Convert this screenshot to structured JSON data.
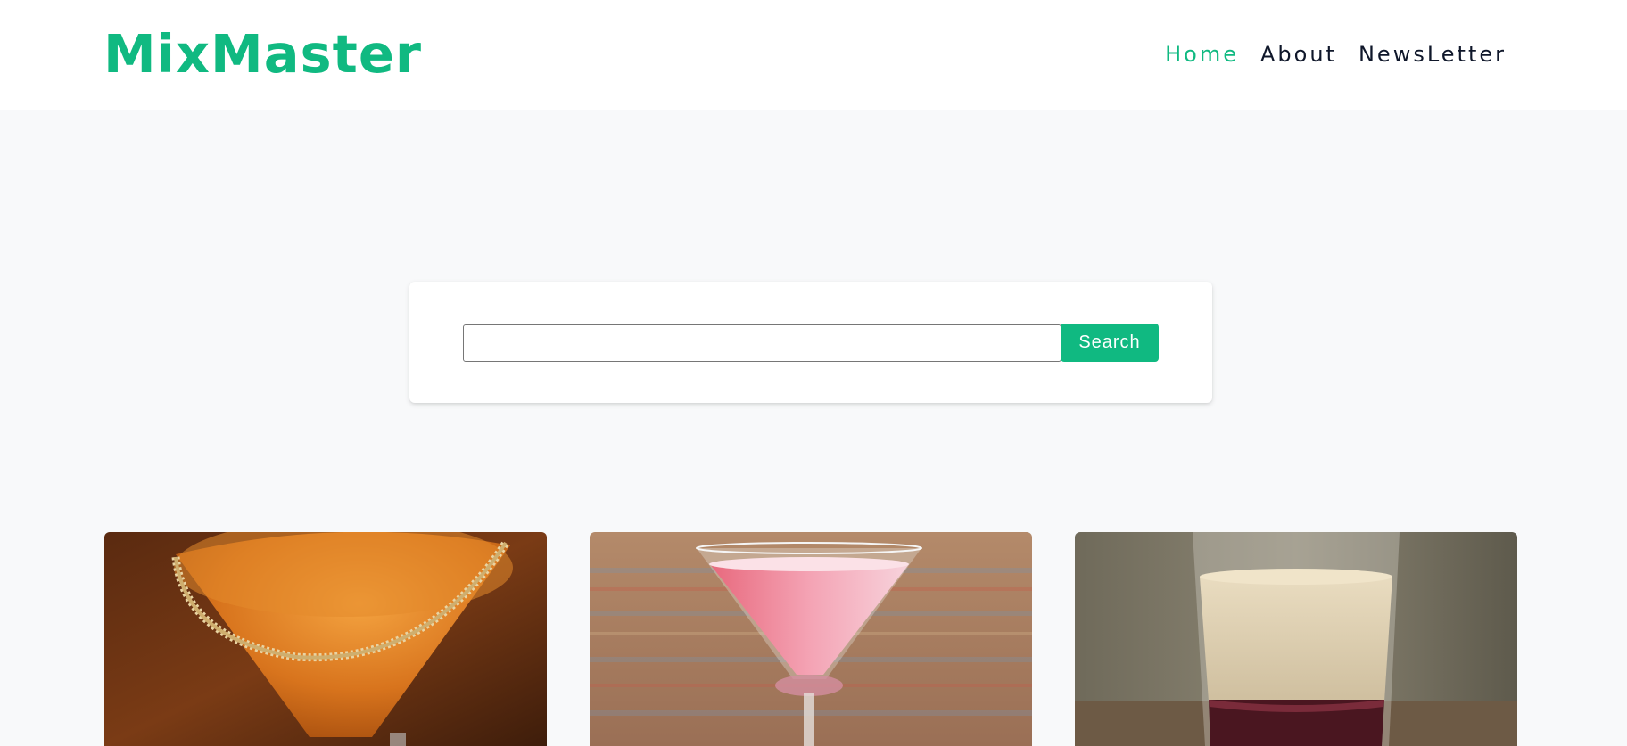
{
  "header": {
    "logo": "MixMaster",
    "nav": [
      {
        "label": "Home",
        "active": true
      },
      {
        "label": "About",
        "active": false
      },
      {
        "label": "NewsLetter",
        "active": false
      }
    ]
  },
  "search": {
    "value": "",
    "placeholder": "",
    "button_label": "Search"
  },
  "cocktails": [
    {
      "image": "orange-martini-with-sugar-rim-photo"
    },
    {
      "image": "pink-martini-photo"
    },
    {
      "image": "layered-cream-shot-glass-photo"
    }
  ],
  "colors": {
    "accent": "#10b981",
    "nav_text": "#0f172a",
    "page_bg": "#f8f9fa"
  }
}
